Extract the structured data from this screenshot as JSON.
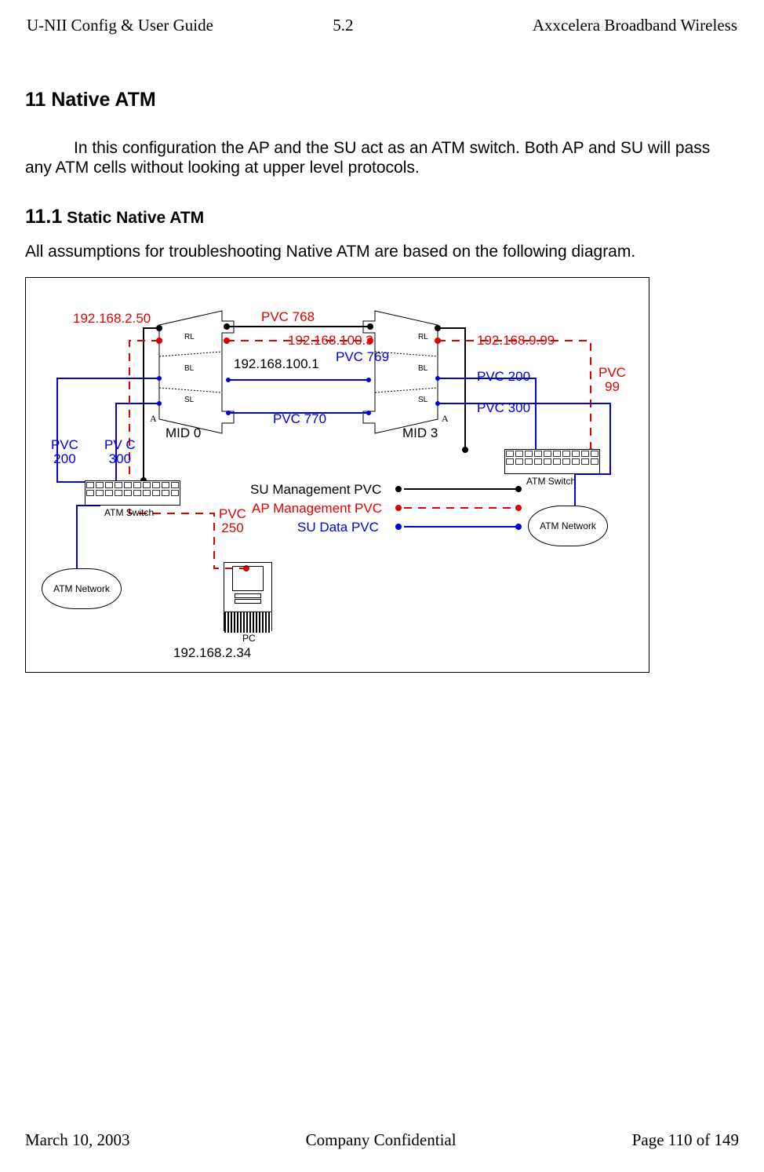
{
  "header": {
    "left": "U-NII Config & User Guide",
    "center": "5.2",
    "right": "Axxcelera Broadband Wireless"
  },
  "h11": "11  Native ATM",
  "para1_indent": "",
  "para1": "In this configuration the AP and the SU act as an ATM switch. Both AP and SU will pass any ATM cells without looking at upper level protocols.",
  "h111_num": "11.1",
  "h111_txt": "Static Native ATM",
  "para2": "All assumptions for troubleshooting Native ATM are based on the following diagram.",
  "footer": {
    "left": "March 10, 2003",
    "center": "Company Confidential",
    "right": "Page 110 of 149"
  },
  "diagram": {
    "ip_ap": "192.168.2.50",
    "ip_su": "192.168.100.3",
    "ip_su_left": "192.168.100.1",
    "ip_right": "192.168.9.99",
    "pvc768": "PVC 768",
    "pvc769": "PVC 769",
    "pvc770": "PVC 770",
    "pvc200_r": "PVC 200",
    "pvc300_r": "PVC 300",
    "pvc99": "PVC 99",
    "pvc200_l": "PVC 200",
    "pvc300_l": "PV C 300",
    "pvc250": "PVC 250",
    "mid0": "MID 0",
    "mid3": "MID 3",
    "rl": "RL",
    "bl": "BL",
    "sl": "SL",
    "A": "A",
    "leg_su_mgmt": "SU Management PVC",
    "leg_ap_mgmt": "AP Management PVC",
    "leg_su_data": "SU Data PVC",
    "atm_switch": "ATM Switch",
    "atm_net": "ATM Network",
    "pc": "PC",
    "pc_ip": "192.168.2.34"
  }
}
